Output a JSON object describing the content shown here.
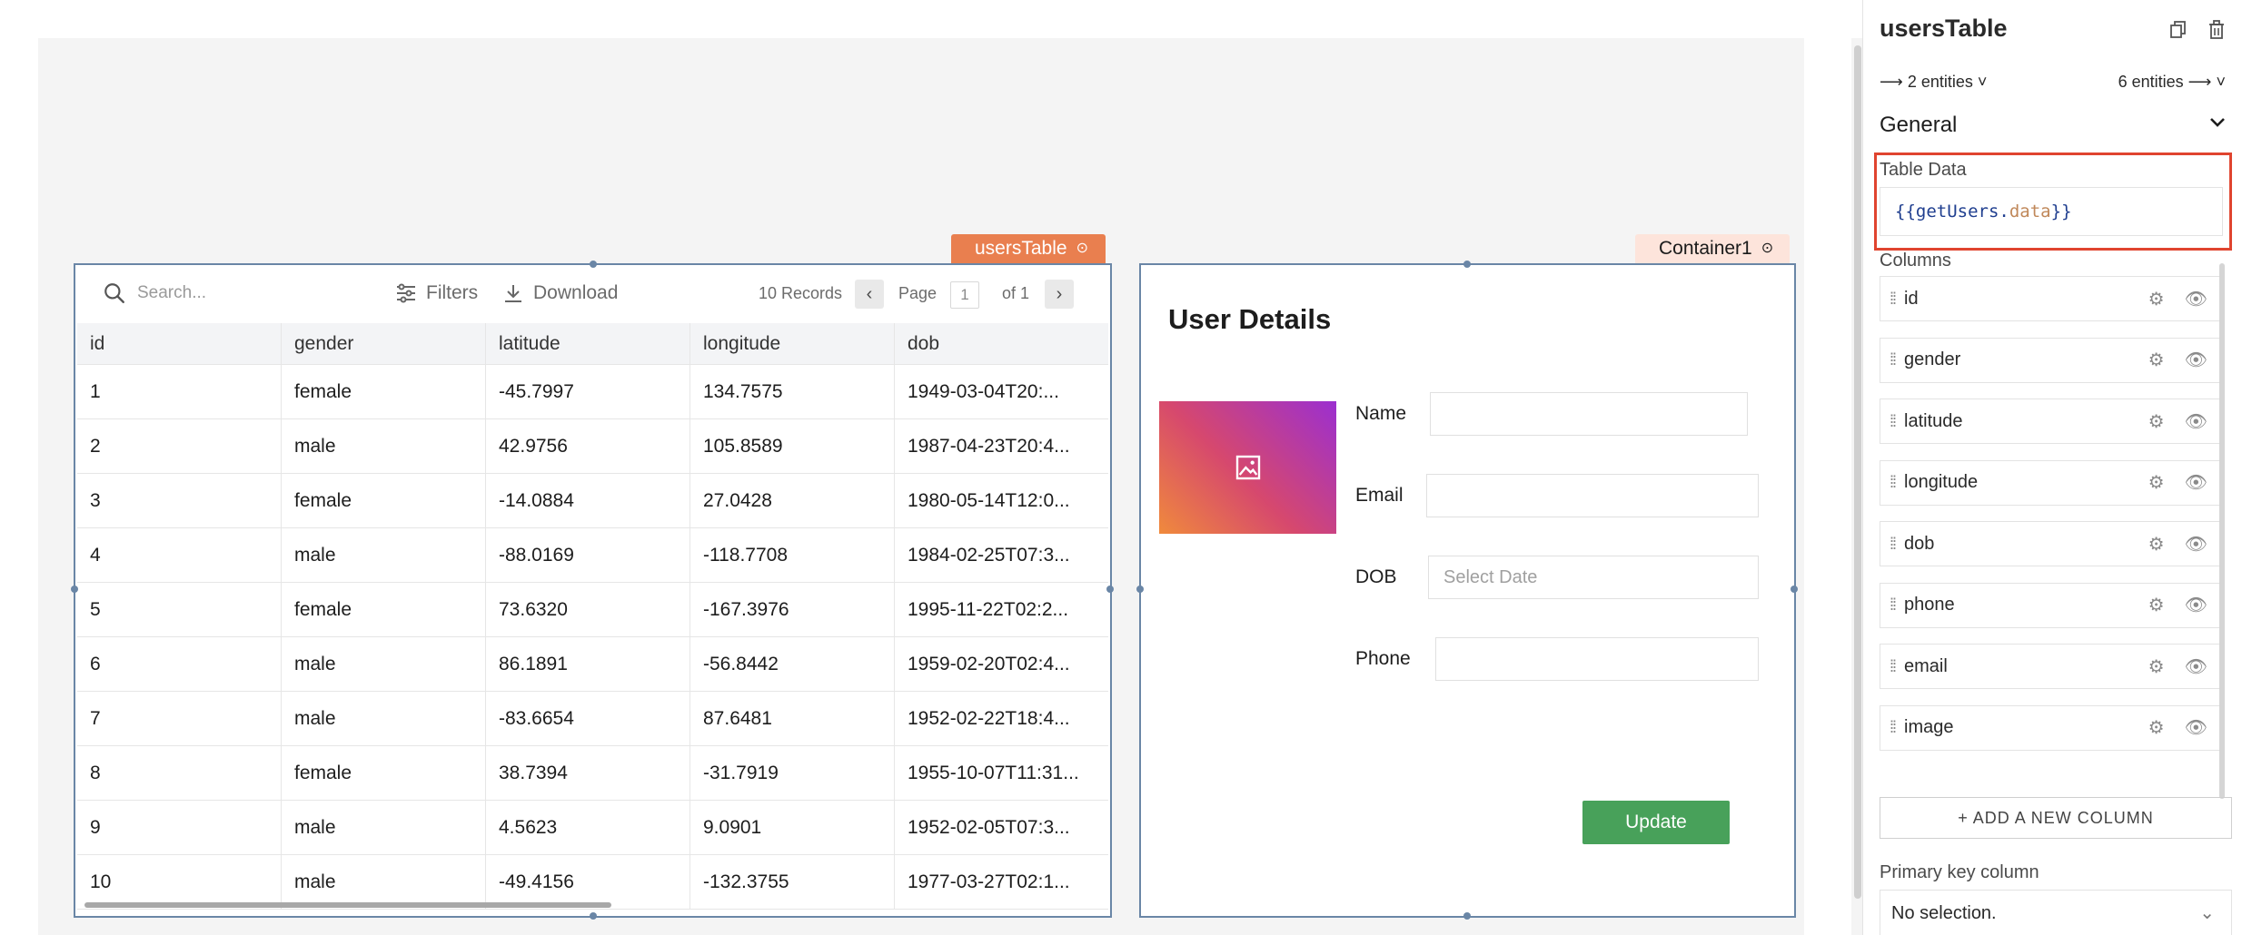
{
  "table_widget": {
    "tag_label": "usersTable",
    "search_placeholder": "Search...",
    "filters_label": "Filters",
    "download_label": "Download",
    "records_label": "10 Records",
    "page_label": "Page",
    "page_value": "1",
    "page_of_label": "of 1",
    "columns": [
      "id",
      "gender",
      "latitude",
      "longitude",
      "dob"
    ],
    "rows": [
      [
        "1",
        "female",
        "-45.7997",
        "134.7575",
        "1949-03-04T20:..."
      ],
      [
        "2",
        "male",
        "42.9756",
        "105.8589",
        "1987-04-23T20:4..."
      ],
      [
        "3",
        "female",
        "-14.0884",
        "27.0428",
        "1980-05-14T12:0..."
      ],
      [
        "4",
        "male",
        "-88.0169",
        "-118.7708",
        "1984-02-25T07:3..."
      ],
      [
        "5",
        "female",
        "73.6320",
        "-167.3976",
        "1995-11-22T02:2..."
      ],
      [
        "6",
        "male",
        "86.1891",
        "-56.8442",
        "1959-02-20T02:4..."
      ],
      [
        "7",
        "male",
        "-83.6654",
        "87.6481",
        "1952-02-22T18:4..."
      ],
      [
        "8",
        "female",
        "38.7394",
        "-31.7919",
        "1955-10-07T11:31..."
      ],
      [
        "9",
        "male",
        "4.5623",
        "9.0901",
        "1952-02-05T07:3..."
      ],
      [
        "10",
        "male",
        "-49.4156",
        "-132.3755",
        "1977-03-27T02:1..."
      ]
    ]
  },
  "container_widget": {
    "tag_label": "Container1",
    "title": "User Details",
    "name_label": "Name",
    "email_label": "Email",
    "dob_label": "DOB",
    "dob_placeholder": "Select Date",
    "phone_label": "Phone",
    "update_label": "Update"
  },
  "property_pane": {
    "title": "usersTable",
    "entities_left": "2 entities",
    "entities_right": "6 entities",
    "section": "General",
    "table_data_label": "Table Data",
    "table_data_code": {
      "open": "{{",
      "object": "getUsers",
      "dot": ".",
      "property": "data",
      "close": "}}"
    },
    "columns_label": "Columns",
    "columns": [
      "id",
      "gender",
      "latitude",
      "longitude",
      "dob",
      "phone",
      "email",
      "image"
    ],
    "add_column_label": "+ ADD A NEW COLUMN",
    "primary_key_label": "Primary key column",
    "primary_key_value": "No selection."
  },
  "colors": {
    "table_tag": "#e97f4f",
    "container_tag": "#fde4db",
    "selection_border": "#6a86a6",
    "highlight": "#e0442f",
    "update_button": "#48a15a"
  }
}
